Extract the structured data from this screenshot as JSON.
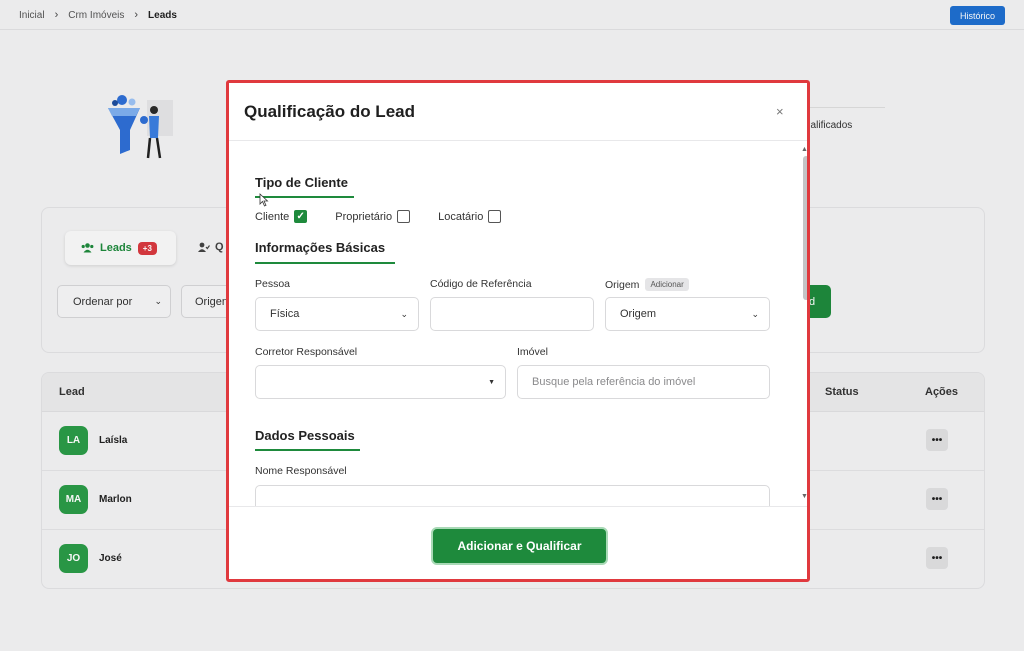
{
  "breadcrumb": {
    "home": "Inicial",
    "crm": "Crm Imóveis",
    "current": "Leads"
  },
  "header": {
    "history_button": "Histórico"
  },
  "hero": {
    "text": "ualificados"
  },
  "tabs": {
    "leads_label": "Leads",
    "leads_badge": "+3",
    "second_label": "Q"
  },
  "filters": {
    "order_label": "Ordenar por",
    "origem_label": "Origen",
    "action_label": "d"
  },
  "table": {
    "headers": {
      "lead": "Lead",
      "status": "Status",
      "actions": "Ações"
    },
    "rows": [
      {
        "initials": "LA",
        "name": "Laísla",
        "actions": "•••"
      },
      {
        "initials": "MA",
        "name": "Marlon",
        "actions": "•••"
      },
      {
        "initials": "JO",
        "name": "José",
        "actions": "•••"
      }
    ]
  },
  "modal": {
    "title": "Qualificação do Lead",
    "close": "×",
    "tipo_cliente": {
      "title": "Tipo de Cliente",
      "options": [
        {
          "label": "Cliente",
          "checked": true
        },
        {
          "label": "Proprietário",
          "checked": false
        },
        {
          "label": "Locatário",
          "checked": false
        }
      ]
    },
    "informacoes": {
      "title": "Informações Básicas",
      "pessoa_label": "Pessoa",
      "pessoa_value": "Física",
      "codigo_label": "Código de Referência",
      "codigo_value": "",
      "origem_label": "Origem",
      "origem_add": "Adicionar",
      "origem_value": "Origem",
      "corretor_label": "Corretor Responsável",
      "corretor_value": "",
      "imovel_label": "Imóvel",
      "imovel_placeholder": "Busque pela referência do imóvel"
    },
    "dados": {
      "title": "Dados Pessoais",
      "nome_label": "Nome Responsável"
    },
    "submit_label": "Adicionar e Qualificar"
  },
  "colors": {
    "accent": "#1e8a3c",
    "primary": "#1e6fd0",
    "highlight_border": "#e0393e",
    "badge": "#d9393f"
  }
}
